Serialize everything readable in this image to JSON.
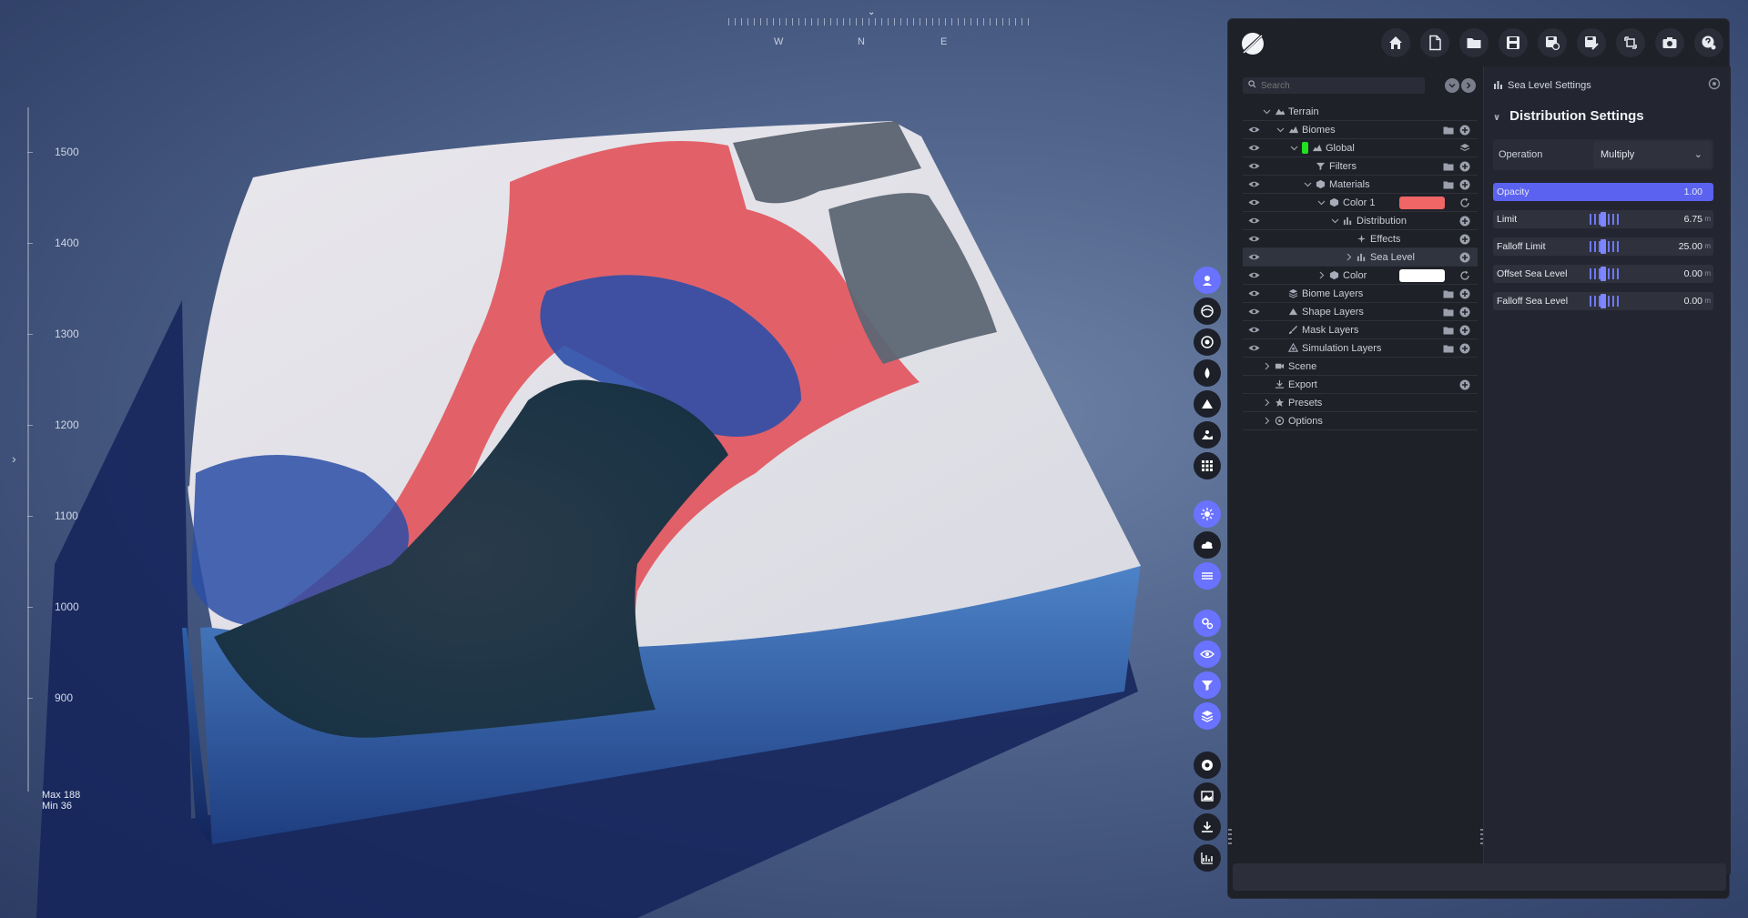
{
  "compass": {
    "letters": [
      "W",
      "N",
      "E"
    ]
  },
  "ruler": {
    "labels": [
      "1500",
      "1400",
      "1300",
      "1200",
      "1100",
      "1000",
      "900"
    ],
    "max": "Max 188",
    "min": "Min 36"
  },
  "terrain_colors": {
    "snow": "#e8e6ea",
    "red": "#e24a52",
    "blue": "#2e4fa8",
    "dark": "#1d3346",
    "rock": "#5a6370",
    "base": "#3d6fb5"
  },
  "side_toolbar": {
    "buttons": [
      {
        "name": "sculpt-icon",
        "active": true
      },
      {
        "name": "globe-icon",
        "active": false
      },
      {
        "name": "rock-icon",
        "active": false
      },
      {
        "name": "water-drop-icon",
        "active": false
      },
      {
        "name": "mountain-icon",
        "active": false
      },
      {
        "name": "landscape-icon",
        "active": false
      },
      {
        "name": "grid-icon",
        "active": false
      },
      {
        "name": "sun-icon",
        "active": true
      },
      {
        "name": "cloud-icon",
        "active": false
      },
      {
        "name": "fog-icon",
        "active": true
      },
      {
        "name": "settings-gears-icon",
        "active": true
      },
      {
        "name": "eye-icon",
        "active": true
      },
      {
        "name": "filter-icon",
        "active": true
      },
      {
        "name": "layers-icon",
        "active": true
      },
      {
        "name": "record-icon",
        "active": false
      },
      {
        "name": "image-icon",
        "active": false
      },
      {
        "name": "download-icon",
        "active": false
      },
      {
        "name": "chart-icon",
        "active": false
      }
    ]
  },
  "topbar": {
    "buttons": [
      "home-icon",
      "new-file-icon",
      "open-folder-icon",
      "save-icon",
      "save-settings-icon",
      "save-as-icon",
      "refresh-icon",
      "camera-icon",
      "help-icon"
    ]
  },
  "search": {
    "placeholder": "Search"
  },
  "tree": {
    "terrain": "Terrain",
    "biomes": "Biomes",
    "global": "Global",
    "filters": "Filters",
    "materials": "Materials",
    "color1": "Color 1",
    "distribution": "Distribution",
    "effects": "Effects",
    "sea_level": "Sea Level",
    "color": "Color",
    "biome_layers": "Biome Layers",
    "shape_layers": "Shape Layers",
    "mask_layers": "Mask Layers",
    "simulation_layers": "Simulation Layers",
    "scene": "Scene",
    "export": "Export",
    "presets": "Presets",
    "options": "Options",
    "color1_swatch": "#f06565",
    "color_swatch": "#ffffff"
  },
  "settings": {
    "header": "Sea Level Settings",
    "section": "Distribution Settings",
    "operation_label": "Operation",
    "operation_value": "Multiply",
    "params": [
      {
        "label": "Opacity",
        "value": "1.00",
        "unit": ""
      },
      {
        "label": "Limit",
        "value": "6.75",
        "unit": "m"
      },
      {
        "label": "Falloff Limit",
        "value": "25.00",
        "unit": "m"
      },
      {
        "label": "Offset Sea Level",
        "value": "0.00",
        "unit": "m"
      },
      {
        "label": "Falloff Sea Level",
        "value": "0.00",
        "unit": "m"
      }
    ]
  }
}
